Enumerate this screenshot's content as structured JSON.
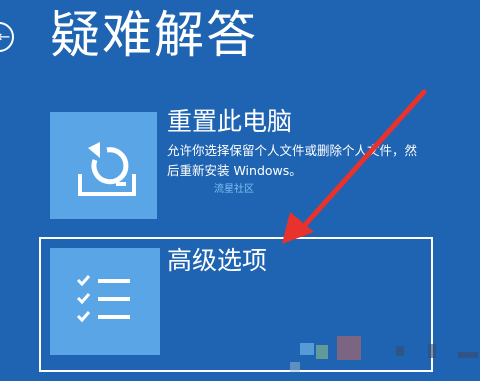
{
  "page": {
    "title": "疑难解答"
  },
  "options": [
    {
      "title": "重置此电脑",
      "description": "允许你选择保留个人文件或删除个人文件，然后重新安装 Windows。",
      "icon": "reset-pc-icon"
    },
    {
      "title": "高级选项",
      "icon": "checklist-icon"
    }
  ],
  "watermark": "流星社区",
  "colors": {
    "background": "#1f64b2",
    "tile": "#5aa5e6",
    "arrow": "#e8322b",
    "text": "#ffffff"
  }
}
